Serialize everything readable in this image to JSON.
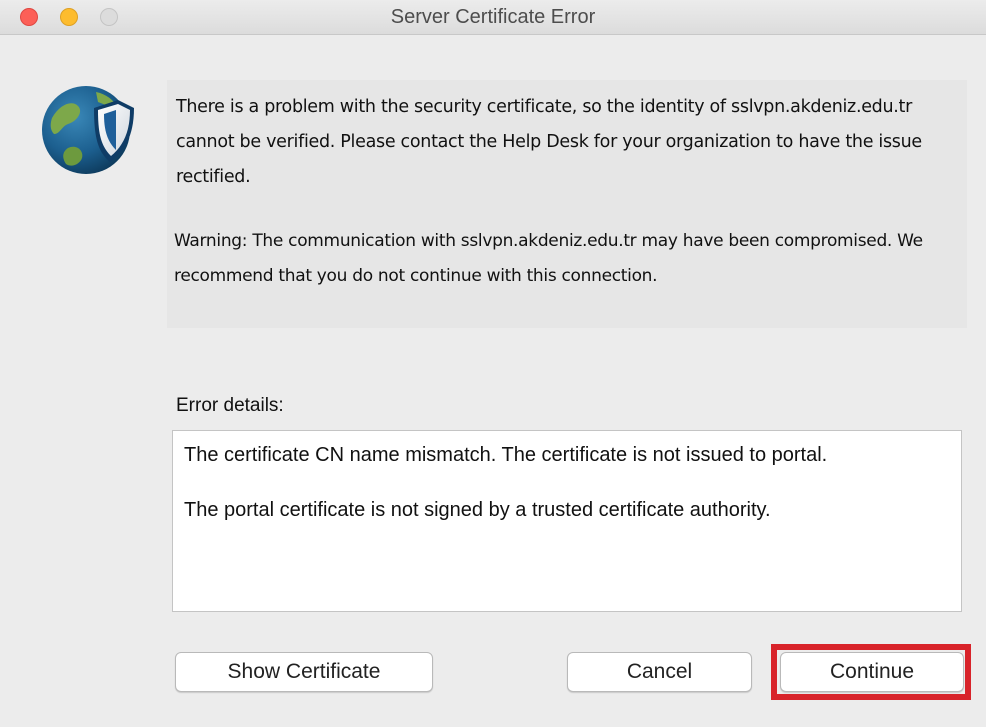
{
  "window": {
    "title": "Server Certificate Error"
  },
  "icon": {
    "name": "globe-shield-icon"
  },
  "message": {
    "primary": "There is a problem with the security certificate, so the identity of sslvpn.akdeniz.edu.tr cannot be verified. Please contact the Help Desk for your organization to have the issue rectified.",
    "warning": "Warning: The communication with sslvpn.akdeniz.edu.tr may have been compromised. We recommend that you do not continue with this connection."
  },
  "details": {
    "label": "Error details:",
    "lines": [
      "The certificate CN name mismatch. The certificate is not issued to portal.",
      "The portal certificate is not signed by a trusted certificate authority."
    ]
  },
  "buttons": {
    "show_certificate": "Show Certificate",
    "cancel": "Cancel",
    "continue": "Continue"
  },
  "colors": {
    "highlight": "#d8232a",
    "close": "#fc5f57",
    "minimize": "#fdbc2e"
  }
}
